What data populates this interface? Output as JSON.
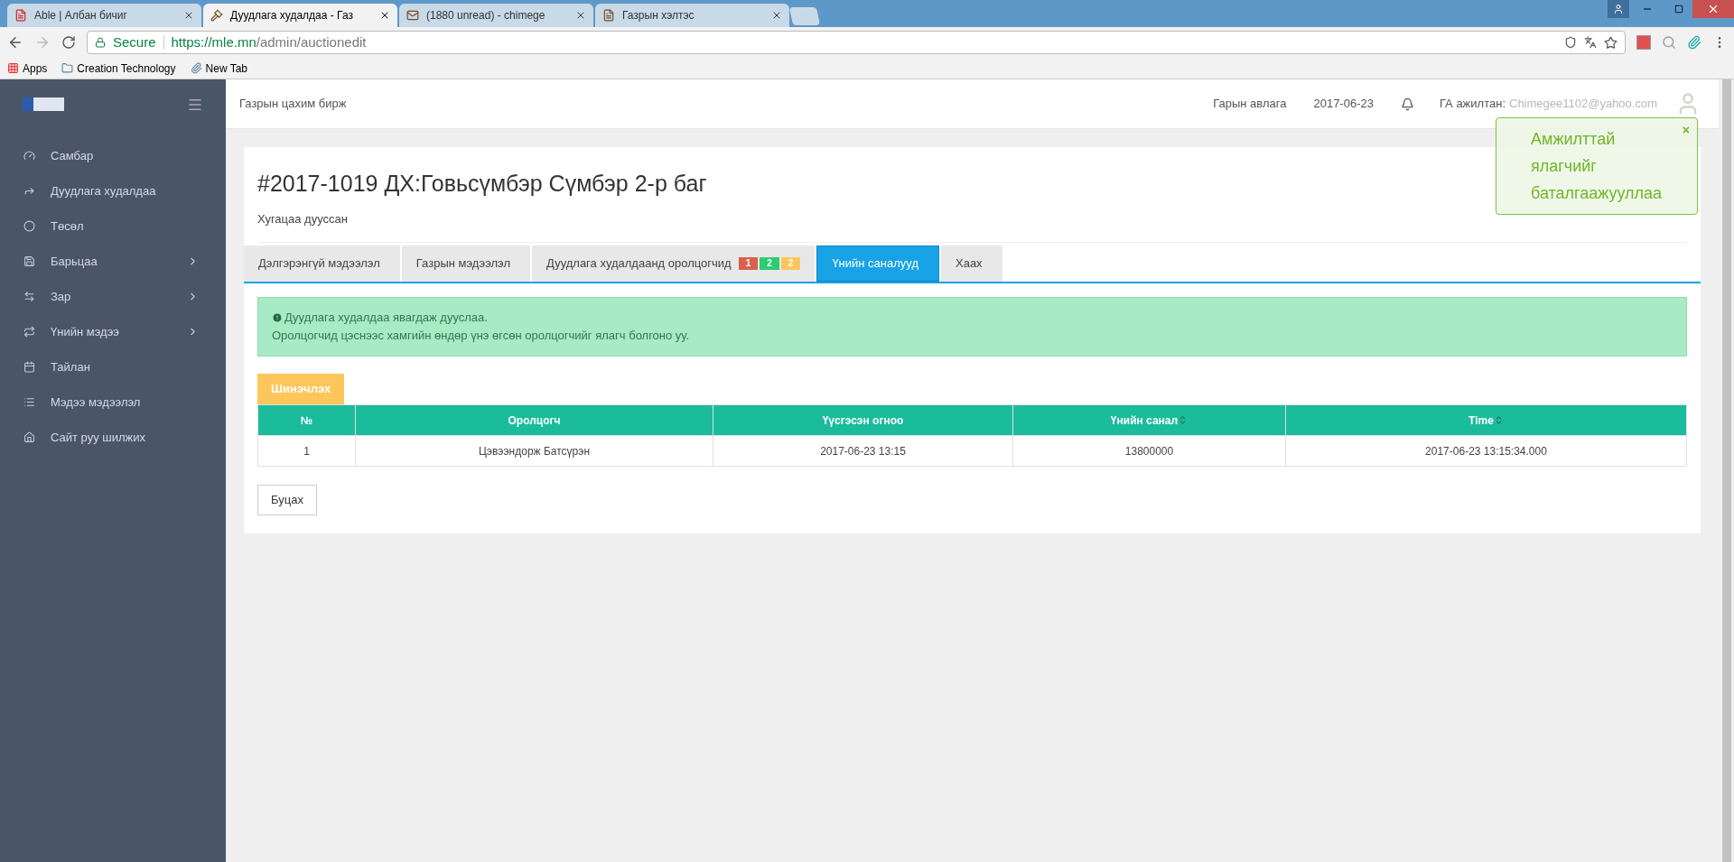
{
  "browser": {
    "tabs": [
      {
        "title": "Able  |  Албан бичиг",
        "selected": false
      },
      {
        "title": "Дуудлага худалдаа - Газ",
        "selected": true
      },
      {
        "title": "(1880 unread) - chimege",
        "selected": false
      },
      {
        "title": "Газрын хэлтэс",
        "selected": false
      }
    ],
    "address": {
      "secure_label": "Secure",
      "url_host": "https://mle.mn",
      "url_path": "/admin/auctionedit"
    },
    "bookmarks": [
      {
        "label": "Apps"
      },
      {
        "label": "Creation Technology"
      },
      {
        "label": "New Tab"
      }
    ]
  },
  "sidebar": {
    "items": [
      {
        "label": "Самбар",
        "has_submenu": false
      },
      {
        "label": "Дуудлага худалдаа",
        "has_submenu": false
      },
      {
        "label": "Төсөл",
        "has_submenu": false
      },
      {
        "label": "Барьцаа",
        "has_submenu": true
      },
      {
        "label": "Зар",
        "has_submenu": true
      },
      {
        "label": "Үнийн мэдээ",
        "has_submenu": true
      },
      {
        "label": "Тайлан",
        "has_submenu": false
      },
      {
        "label": "Мэдээ мэдээлэл",
        "has_submenu": false
      },
      {
        "label": "Сайт руу шилжих",
        "has_submenu": false
      }
    ]
  },
  "header": {
    "site_title": "Газрын цахим бирж",
    "links": [
      "Гарын авлага",
      "2017-06-23"
    ],
    "user_role": "ГА ажилтан:",
    "user_email": "Chimegee1102@yahoo.com"
  },
  "toast": {
    "message": "Амжилттай ялагчийг баталгаажууллаа",
    "close": "×"
  },
  "auction": {
    "title": "#2017-1019 ДХ:Говьсүмбэр Сүмбэр 2-р баг",
    "status": "Хугацаа дууссан",
    "tabs": [
      {
        "label": "Дэлгэрэнгүй мэдээлэл",
        "selected": false
      },
      {
        "label": "Газрын мэдээлэл",
        "selected": false
      },
      {
        "label": "Дуудлага худалдаанд оролцогчид",
        "selected": false,
        "badges": [
          {
            "text": "1",
            "color": "#d9604f"
          },
          {
            "text": "2",
            "color": "#2ecc71"
          },
          {
            "text": "2",
            "color": "#fdc65b"
          }
        ]
      },
      {
        "label": "Үнийн саналууд",
        "selected": true
      },
      {
        "label": "Хаах",
        "selected": false
      }
    ],
    "alert": {
      "title": "Дуудлага худалдаа явагдаж дууслаа.",
      "text": "Оролцогчид цэснээс хамгийн өндөр үнэ өгсөн оролцогчийг ялагч болгоно уу."
    },
    "refresh_button": "Шинэчлэх",
    "table": {
      "columns": [
        {
          "label": "№",
          "sortable": false
        },
        {
          "label": "Оролцогч",
          "sortable": false
        },
        {
          "label": "Үүсгэсэн огноо",
          "sortable": false
        },
        {
          "label": "Үнийн санал",
          "sortable": true
        },
        {
          "label": "Time",
          "sortable": true
        }
      ],
      "rows": [
        [
          "1",
          "Цэвээндорж Батсүрэн",
          "2017-06-23 13:15",
          "13800000",
          "2017-06-23 13:15:34.000"
        ]
      ]
    },
    "back_button": "Буцах"
  }
}
